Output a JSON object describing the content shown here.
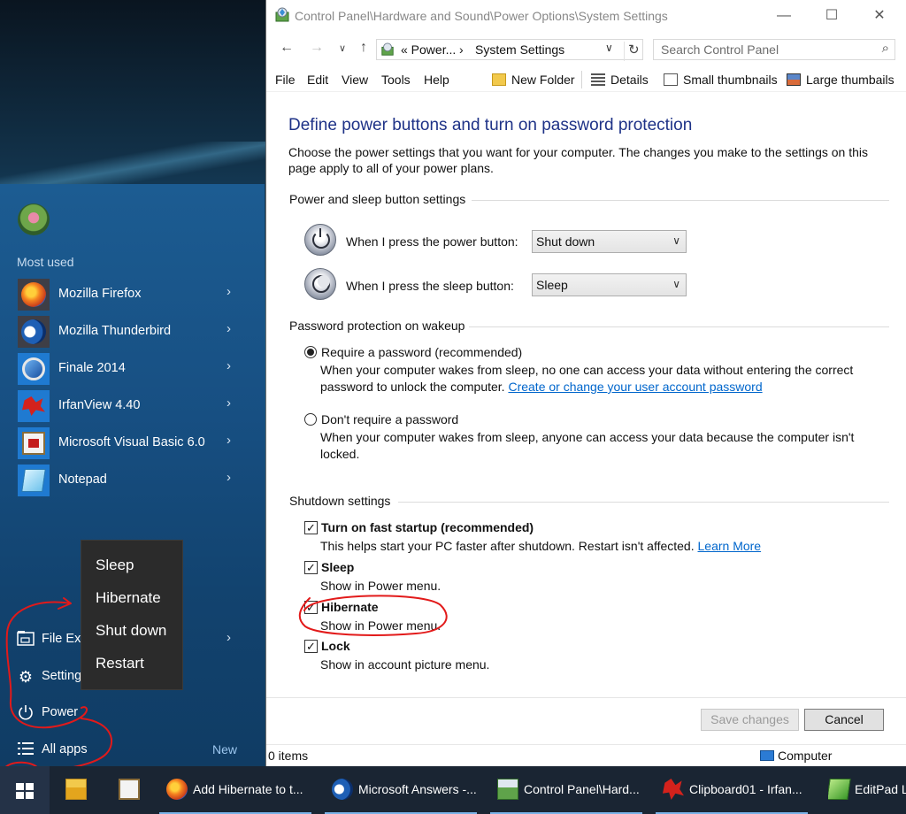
{
  "start_menu": {
    "section_title": "Most used",
    "apps": [
      {
        "label": "Mozilla Firefox",
        "icon": "firefox-icon"
      },
      {
        "label": "Mozilla Thunderbird",
        "icon": "thunderbird-icon"
      },
      {
        "label": "Finale 2014",
        "icon": "finale-icon"
      },
      {
        "label": "IrfanView 4.40",
        "icon": "irfanview-icon"
      },
      {
        "label": "Microsoft Visual Basic 6.0",
        "icon": "visual-basic-icon"
      },
      {
        "label": "Notepad",
        "icon": "notepad-icon"
      }
    ],
    "bottom": {
      "file_explorer": "File Exp",
      "settings": "Settings",
      "power": "Power",
      "all_apps": "All apps",
      "new_badge": "New"
    }
  },
  "power_menu": {
    "items": [
      "Sleep",
      "Hibernate",
      "Shut down",
      "Restart"
    ]
  },
  "window": {
    "title": "Control Panel\\Hardware and Sound\\Power Options\\System Settings",
    "address": {
      "path_short": "« Power...",
      "path_current": "System Settings"
    },
    "search_placeholder": "Search Control Panel",
    "menu": [
      "File",
      "Edit",
      "View",
      "Tools",
      "Help"
    ],
    "toolbar": {
      "new_folder": "New Folder",
      "details": "Details",
      "small_thumbnails": "Small thumbnails",
      "large_thumbnails": "Large thumbails"
    },
    "page_title": "Define power buttons and turn on password protection",
    "page_desc": "Choose the power settings that you want for your computer. The changes you make to the settings on this page apply to all of your power plans.",
    "power_sleep_group": "Power and sleep button settings",
    "power_button_label": "When I press the power button:",
    "power_button_value": "Shut down",
    "sleep_button_label": "When I press the sleep button:",
    "sleep_button_value": "Sleep",
    "password_group": "Password protection on wakeup",
    "require_password": {
      "label": "Require a password (recommended)",
      "desc_before": "When your computer wakes from sleep, no one can access your data without entering the correct password to unlock the computer. ",
      "link": "Create or change your user account password",
      "selected": true
    },
    "no_password": {
      "label": "Don't require a password",
      "desc": "When your computer wakes from sleep, anyone can access your data because the computer isn't locked.",
      "selected": false
    },
    "shutdown_group": "Shutdown settings",
    "shutdown_options": [
      {
        "label": "Turn on fast startup (recommended)",
        "desc": "This helps start your PC faster after shutdown. Restart isn't affected. ",
        "link": "Learn More",
        "checked": true
      },
      {
        "label": "Sleep",
        "desc": "Show in Power menu.",
        "checked": true
      },
      {
        "label": "Hibernate",
        "desc": "Show in Power menu.",
        "checked": true
      },
      {
        "label": "Lock",
        "desc": "Show in account picture menu.",
        "checked": true
      }
    ],
    "save_button": "Save changes",
    "cancel_button": "Cancel",
    "status_items": "0 items",
    "status_location": "Computer"
  },
  "taskbar": {
    "apps": [
      {
        "label": "",
        "icon": "file-explorer-icon"
      },
      {
        "label": "",
        "icon": "visual-basic-icon"
      },
      {
        "label": "Add Hibernate to t...",
        "icon": "firefox-icon"
      },
      {
        "label": "Microsoft Answers -...",
        "icon": "thunderbird-icon"
      },
      {
        "label": "Control Panel\\Hard...",
        "icon": "control-panel-icon"
      },
      {
        "label": "Clipboard01 - Irfan...",
        "icon": "irfanview-icon"
      },
      {
        "label": "EditPad L",
        "icon": "editpad-icon"
      }
    ]
  },
  "colors": {
    "title_blue": "#1e3287",
    "link_blue": "#0066cc",
    "annotation_red": "#e21a1a",
    "start_blue": "#174f82"
  }
}
